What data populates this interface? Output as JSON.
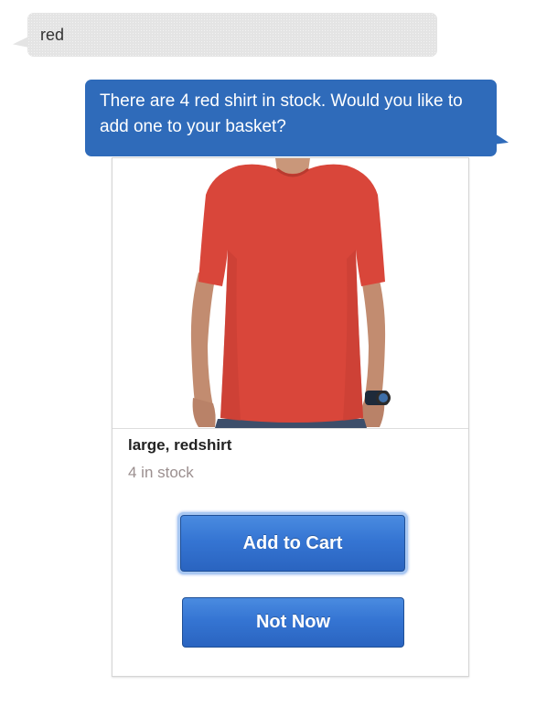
{
  "conversation": {
    "user_message": "red",
    "bot_message": "There are 4 red shirt in stock. Would you like to add one to your basket?"
  },
  "product_card": {
    "image_icon": "red-tshirt-product-photo",
    "title": "large, redshirt",
    "stock": "4 in stock",
    "add_to_cart_label": "Add to Cart",
    "not_now_label": "Not Now"
  },
  "colors": {
    "user_bubble": "#e4e4e4",
    "bot_bubble": "#2f6bba",
    "button": "#3575d3",
    "shirt": "#d9463a"
  }
}
